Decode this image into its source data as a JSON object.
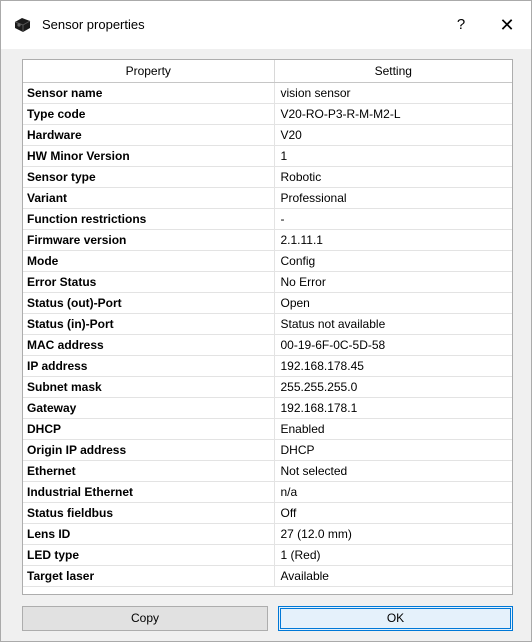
{
  "window": {
    "title": "Sensor properties",
    "help_label": "?",
    "close_label": "✕"
  },
  "table": {
    "headers": [
      "Property",
      "Setting"
    ],
    "rows": [
      [
        "Sensor name",
        "vision sensor"
      ],
      [
        "Type code",
        "V20-RO-P3-R-M-M2-L"
      ],
      [
        "Hardware",
        "V20"
      ],
      [
        "HW Minor Version",
        "1"
      ],
      [
        "Sensor type",
        "Robotic"
      ],
      [
        "Variant",
        "Professional"
      ],
      [
        "Function restrictions",
        "-"
      ],
      [
        "Firmware version",
        "2.1.11.1"
      ],
      [
        "Mode",
        "Config"
      ],
      [
        "Error Status",
        "No Error"
      ],
      [
        "Status (out)-Port",
        "Open"
      ],
      [
        "Status (in)-Port",
        "Status not available"
      ],
      [
        "MAC address",
        "00-19-6F-0C-5D-58"
      ],
      [
        "IP address",
        "192.168.178.45"
      ],
      [
        "Subnet mask",
        "255.255.255.0"
      ],
      [
        "Gateway",
        "192.168.178.1"
      ],
      [
        "DHCP",
        "Enabled"
      ],
      [
        "Origin IP address",
        "DHCP"
      ],
      [
        "Ethernet",
        "Not selected"
      ],
      [
        "Industrial Ethernet",
        "n/a"
      ],
      [
        "Status fieldbus",
        "Off"
      ],
      [
        "Lens ID",
        "27 (12.0 mm)"
      ],
      [
        "LED type",
        "1 (Red)"
      ],
      [
        "Target laser",
        "Available"
      ]
    ]
  },
  "buttons": {
    "copy_label": "Copy",
    "ok_label": "OK"
  }
}
